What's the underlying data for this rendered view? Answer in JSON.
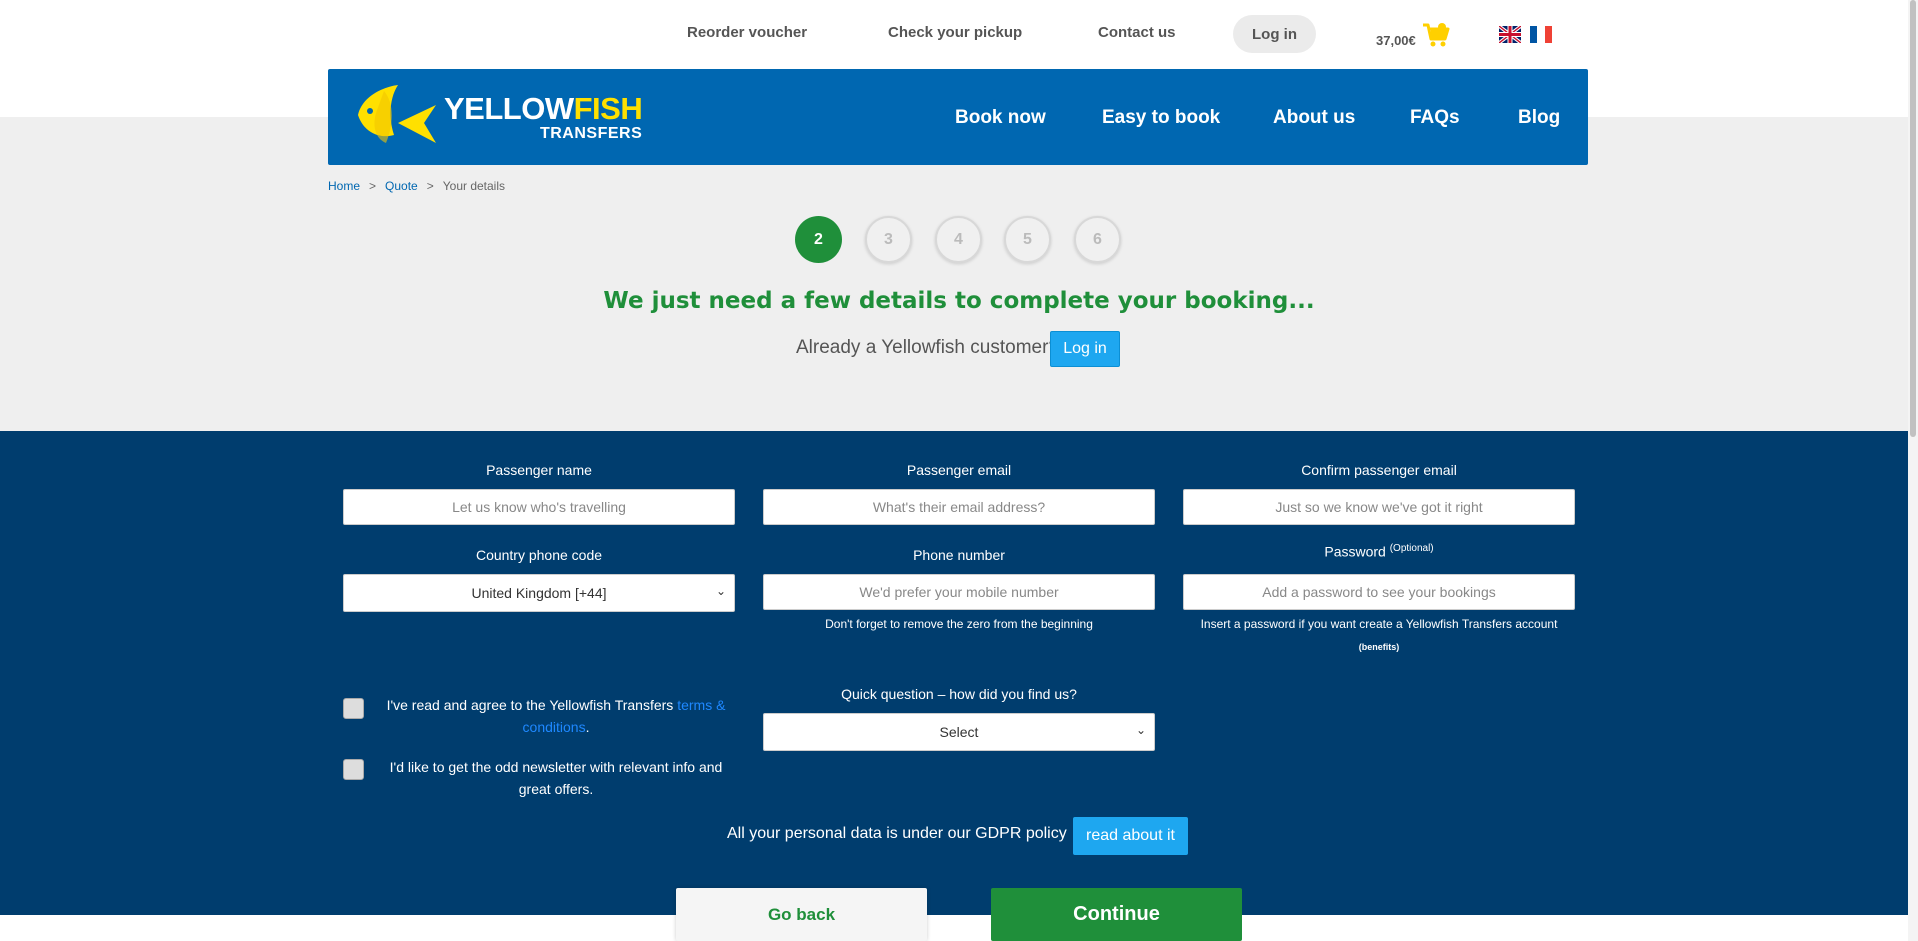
{
  "top_nav": {
    "reorder": "Reorder voucher",
    "pickup": "Check your pickup",
    "contact": "Contact us",
    "login": "Log in",
    "cart_amount": "37,00€",
    "cart_icon": "cart-icon",
    "flags": [
      "uk-flag-icon",
      "fr-flag-icon"
    ]
  },
  "header": {
    "logo_main_a": "YELLOW",
    "logo_main_b": "FISH",
    "logo_sub": "TRANSFERS",
    "nav": [
      "Book now",
      "Easy to book",
      "About us",
      "FAQs",
      "Blog"
    ],
    "bg_color": "#0067b1",
    "accent_color": "#ffe000"
  },
  "breadcrumb": {
    "home": "Home",
    "sep": ">",
    "quote": "Quote",
    "current": "Your details"
  },
  "steps": {
    "active": "2",
    "inactive": [
      "3",
      "4",
      "5",
      "6"
    ],
    "active_color": "#1f8f3a"
  },
  "hero": {
    "headline": "We just need a few details to complete your booking...",
    "already_customer": "Already a Yellowfish customer?",
    "login_button": "Log in"
  },
  "form": {
    "passenger_name": {
      "label": "Passenger name",
      "placeholder": "Let us know who's travelling"
    },
    "passenger_email": {
      "label": "Passenger email",
      "placeholder": "What's their email address?"
    },
    "confirm_email": {
      "label": "Confirm passenger email",
      "placeholder": "Just so we know we've got it right"
    },
    "country_code": {
      "label": "Country phone code",
      "value": "United Kingdom [+44]"
    },
    "phone": {
      "label": "Phone number",
      "placeholder": "We'd prefer your mobile number",
      "hint": "Don't forget to remove the zero from the beginning"
    },
    "password": {
      "label": "Password",
      "optional": "(Optional)",
      "placeholder": "Add a password to see your bookings",
      "hint": "Insert a password if you want create a Yellowfish Transfers account",
      "benefits": "(benefits)"
    },
    "terms": {
      "text": "I've read and agree to the Yellowfish Transfers",
      "link": "terms & conditions",
      "end": "."
    },
    "newsletter": {
      "text": "I'd like to get the odd newsletter with relevant info and great offers."
    },
    "how_found": {
      "label": "Quick question – how did you find us?",
      "value": "Select"
    },
    "gdpr_text": "All your personal data is under our GDPR policy",
    "gdpr_button": "read about it",
    "panel_color": "#003d6e"
  },
  "actions": {
    "go_back": "Go back",
    "continue": "Continue"
  }
}
